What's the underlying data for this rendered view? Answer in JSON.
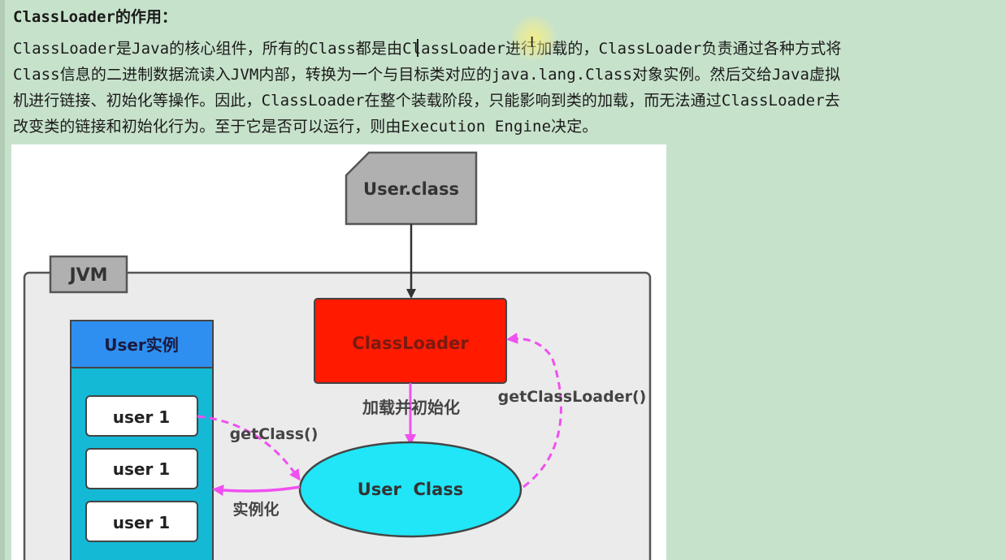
{
  "heading": "ClassLoader的作用：",
  "paragraph": [
    "ClassLoader是Java的核心组件，所有的Class都是由ClassLoader进行加载的，ClassLoader负责通过各种方式将",
    "Class信息的二进制数据流读入JVM内部，转换为一个与目标类对应的java.lang.Class对象实例。然后交给Java虚拟",
    "机进行链接、初始化等操作。因此，ClassLoader在整个装载阶段，只能影响到类的加载，而无法通过ClassLoader去",
    "改变类的链接和初始化行为。至于它是否可以运行，则由Execution Engine决定。"
  ],
  "diagram": {
    "file_label": "User.class",
    "jvm_label": "JVM",
    "classloader_label": "ClassLoader",
    "instances_header": "User实例",
    "instances": [
      "user 1",
      "user 1",
      "user 1"
    ],
    "user_class_label": "User  Class",
    "load_init_label": "加载并初始化",
    "get_classloader_label": "getClassLoader()",
    "get_class_label": "getClass()",
    "instantiate_label": "实例化",
    "colors": {
      "classloader_fill": "#ff1a00",
      "instances_header_fill": "#2f8ff0",
      "instances_body_fill": "#14b9d6",
      "user_class_fill": "#20e6f7",
      "arrow_magenta": "#f050f0",
      "jvm_fill": "#ebebeb",
      "file_fill": "#b0b0b0"
    }
  }
}
